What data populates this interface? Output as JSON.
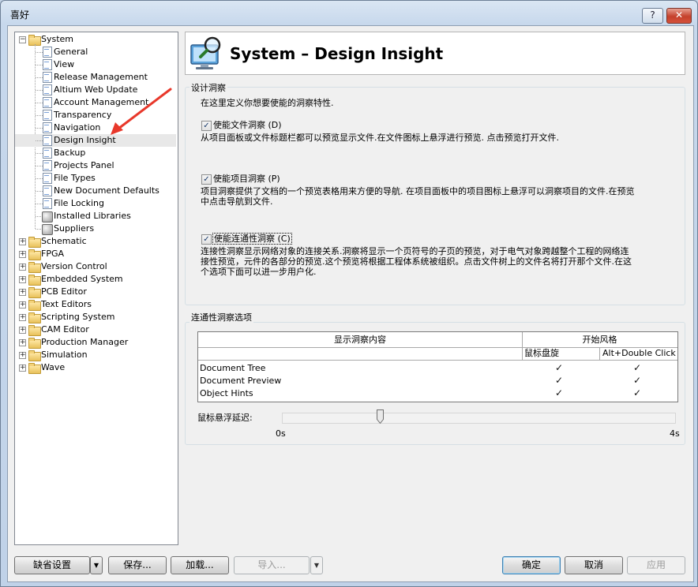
{
  "window": {
    "title": "喜好",
    "help_label": "?",
    "close_label": "✕"
  },
  "tree": {
    "root": "System",
    "system_children": [
      "General",
      "View",
      "Release Management",
      "Altium Web Update",
      "Account Management",
      "Transparency",
      "Navigation",
      "Design Insight",
      "Backup",
      "Projects Panel",
      "File Types",
      "New Document Defaults",
      "File Locking",
      "Installed Libraries",
      "Suppliers"
    ],
    "selected": "Design Insight",
    "top_level": [
      "Schematic",
      "FPGA",
      "Version Control",
      "Embedded System",
      "PCB Editor",
      "Text Editors",
      "Scripting System",
      "CAM Editor",
      "Production Manager",
      "Simulation",
      "Wave"
    ]
  },
  "header": {
    "title": "System – Design Insight",
    "icon": "monitor-magnifier-icon"
  },
  "design_insight": {
    "group_label": "设计洞察",
    "intro": "在这里定义你想要使能的洞察特性.",
    "options": [
      {
        "label": "使能文件洞察 (D)",
        "checked": true,
        "description": [
          "从项目面板或文件标题栏都可以预览显示文件.在文件图标上悬浮进行预览. 点击预览打开文件."
        ]
      },
      {
        "label": "使能项目洞察 (P)",
        "checked": true,
        "description": [
          "项目洞察提供了文档的一个预览表格用来方便的导航. 在项目面板中的项目图标上悬浮可以洞察项目的文件.在预览",
          "中点击导航到文件."
        ]
      },
      {
        "label": "使能连通性洞察 (C)",
        "checked": true,
        "description": [
          "连接性洞察显示网络对象的连接关系.洞察将显示一个页符号的子页的预览，对于电气对象跨越整个工程的网络连",
          "接性预览，元件的各部分的预览.这个预览将根据工程体系统被组织。点击文件树上的文件名将打开那个文件.在这",
          "个选项下面可以进一步用户化."
        ]
      }
    ]
  },
  "connectivity": {
    "group_label": "连通性洞察选项",
    "table": {
      "col_content": "显示洞察内容",
      "col_style": "开始风格",
      "sub_hover": "鼠标盘旋",
      "sub_alt": "Alt+Double Click",
      "rows": [
        {
          "name": "Document Tree",
          "hover": true,
          "alt": true
        },
        {
          "name": "Document Preview",
          "hover": true,
          "alt": true
        },
        {
          "name": "Object Hints",
          "hover": true,
          "alt": true
        }
      ]
    },
    "delay_label": "鼠标悬浮延迟:",
    "delay_min": "0s",
    "delay_max": "4s",
    "delay_fraction": 0.25
  },
  "footer": {
    "defaults": "缺省设置",
    "save": "保存...",
    "load": "加载...",
    "import": "导入...",
    "ok": "确定",
    "cancel": "取消",
    "apply": "应用"
  },
  "colors": {
    "arrow": "#e8382b"
  }
}
